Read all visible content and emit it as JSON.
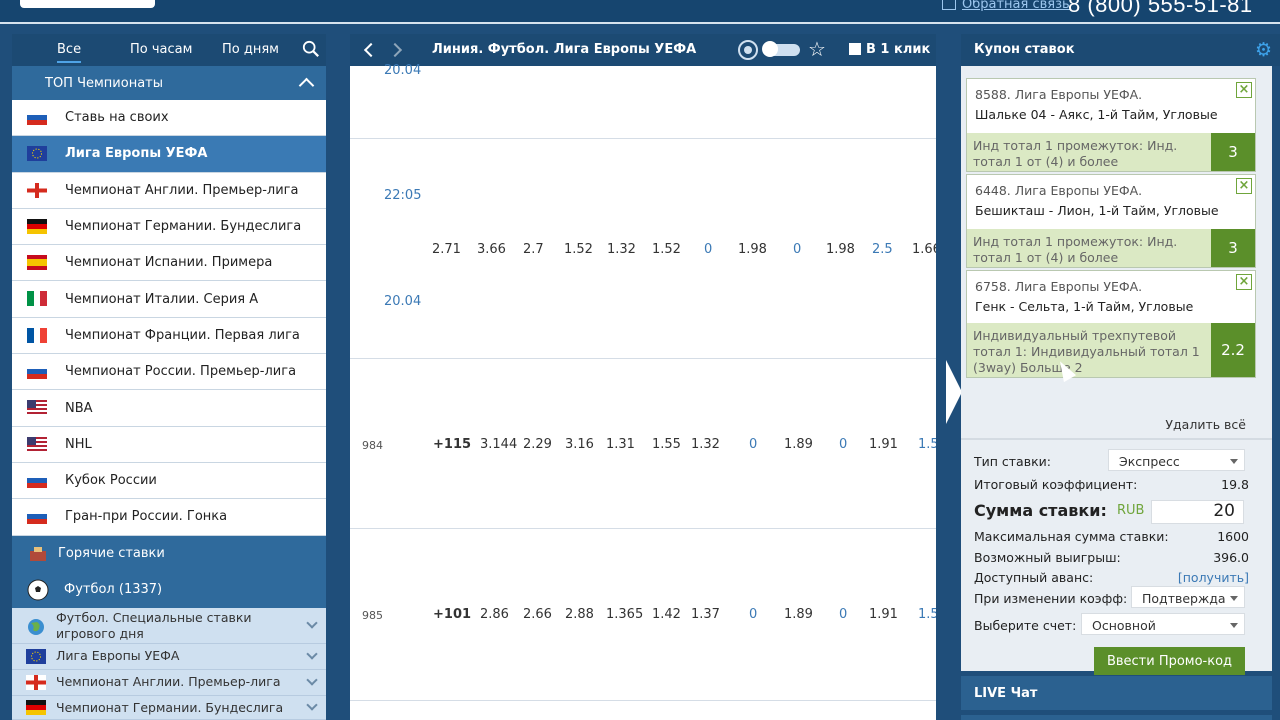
{
  "header": {
    "feedback": "Обратная связь",
    "phone": "8 (800) 555-51-81"
  },
  "left": {
    "tabs": [
      "Все",
      "По часам",
      "По дням"
    ],
    "top_title": "ТОП Чемпионаты",
    "items": [
      {
        "label": "Ставь на своих",
        "flag": "ru"
      },
      {
        "label": "Лига Европы УЕФА",
        "flag": "eu",
        "selected": true
      },
      {
        "label": "Чемпионат Англии. Премьер-лига",
        "flag": "en"
      },
      {
        "label": "Чемпионат Германии. Бундеслига",
        "flag": "de"
      },
      {
        "label": "Чемпионат Испании. Примера",
        "flag": "es"
      },
      {
        "label": "Чемпионат Италии. Серия А",
        "flag": "it"
      },
      {
        "label": "Чемпионат Франции. Первая лига",
        "flag": "fr"
      },
      {
        "label": "Чемпионат России. Премьер-лига",
        "flag": "ru"
      },
      {
        "label": "NBA",
        "flag": "us"
      },
      {
        "label": "NHL",
        "flag": "us"
      },
      {
        "label": "Кубок России",
        "flag": "ru"
      },
      {
        "label": "Гран-при России. Гонка",
        "flag": "ru"
      }
    ],
    "hot": "Горячие ставки",
    "football": "Футбол (1337)",
    "sub": [
      {
        "label": "Футбол. Специальные ставки игрового дня",
        "flag": "globe"
      },
      {
        "label": "Лига Европы УЕФА",
        "flag": "eu"
      },
      {
        "label": "Чемпионат Англии. Премьер-лига",
        "flag": "en"
      },
      {
        "label": "Чемпионат Германии. Бундеслига",
        "flag": "de"
      }
    ]
  },
  "center": {
    "title": "Линия. Футбол. Лига Европы УЕФА",
    "oneclick": "В 1 клик",
    "times": [
      "20.04",
      "22:05",
      "20.04"
    ],
    "rows": [
      {
        "num": "",
        "plus": "",
        "odds": [
          "2.71",
          "3.66",
          "2.7",
          "1.52",
          "1.32",
          "1.52",
          "0",
          "1.98",
          "0",
          "1.98",
          "2.5",
          "1.66"
        ]
      },
      {
        "num": "984",
        "plus": "+115",
        "odds": [
          "3.144",
          "2.29",
          "3.16",
          "1.31",
          "1.55",
          "1.32",
          "0",
          "1.89",
          "0",
          "1.91",
          "1.5"
        ]
      },
      {
        "num": "985",
        "plus": "+101",
        "odds": [
          "2.86",
          "2.66",
          "2.88",
          "1.365",
          "1.42",
          "1.37",
          "0",
          "1.89",
          "0",
          "1.91",
          "1.5"
        ]
      }
    ]
  },
  "coupon": {
    "title": "Купон ставок",
    "bets": [
      {
        "line1": "8588. Лига Европы УЕФА.",
        "line2": "Шальке 04 - Аякс, 1-й Тайм, Угловые",
        "outcome": "Инд тотал 1 промежуток: Инд. тотал 1 от (4) и более",
        "coef": "3"
      },
      {
        "line1": "6448. Лига Европы УЕФА.",
        "line2": "Бешикташ - Лион, 1-й Тайм, Угловые",
        "outcome": "Инд тотал 1 промежуток: Инд. тотал 1 от (4) и более",
        "coef": "3"
      },
      {
        "line1": "6758. Лига Европы УЕФА.",
        "line2": "Генк - Сельта, 1-й Тайм, Угловые",
        "outcome": "Индивидуальный трехпутевой тотал 1: Индивидуальный тотал 1 (3way) Больше 2",
        "coef": "2.2"
      }
    ],
    "delete_all": "Удалить всё",
    "bet_type_label": "Тип ставки:",
    "bet_type": "Экспресс",
    "total_coef_label": "Итоговый коэффициент:",
    "total_coef": "19.8",
    "sum_label": "Сумма ставки:",
    "currency": "RUB",
    "sum": "20",
    "max_label": "Максимальная сумма ставки:",
    "max": "1600",
    "win_label": "Возможный выигрыш:",
    "win": "396.0",
    "advance_label": "Доступный аванс:",
    "advance_link": "[получить]",
    "change_label": "При изменении коэфф:",
    "change_value": "Подтвержда",
    "account_label": "Выберите счет:",
    "account_value": "Основной",
    "promo": "Ввести Промо-код",
    "live_chat": "LIVE Чат"
  }
}
